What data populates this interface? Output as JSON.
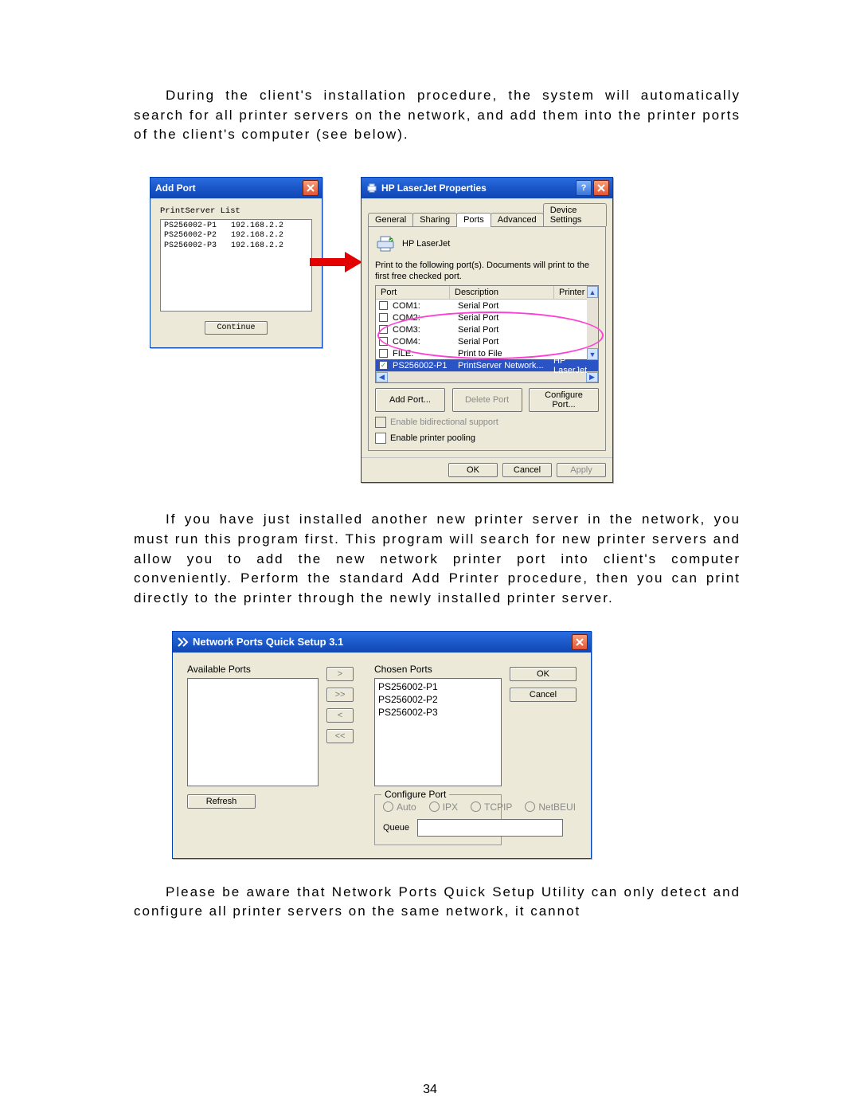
{
  "para1": "During the client's installation procedure, the system will automatically search for all printer servers on the network, and add them into the printer ports of the client's computer (see below).",
  "para2": "If you have just installed another new printer server in the network, you must run this program first. This program will search for new printer servers and allow you to add the new network printer port into client's computer conveniently. Perform the standard Add Printer procedure, then you can print directly to the printer through the newly installed printer server.",
  "para3": "Please be aware that Network Ports Quick Setup Utility can only detect and configure all printer servers on the same network, it cannot",
  "page_number": "34",
  "addport": {
    "title": "Add Port",
    "list_label": "PrintServer List",
    "rows": [
      {
        "name": "PS256002-P1",
        "ip": "192.168.2.2"
      },
      {
        "name": "PS256002-P2",
        "ip": "192.168.2.2"
      },
      {
        "name": "PS256002-P3",
        "ip": "192.168.2.2"
      }
    ],
    "continue": "Continue"
  },
  "props": {
    "title": "HP LaserJet Properties",
    "tabs": [
      "General",
      "Sharing",
      "Ports",
      "Advanced",
      "Device Settings"
    ],
    "active_tab": 2,
    "printer_name": "HP LaserJet",
    "instruction": "Print to the following port(s). Documents will print to the first free checked port.",
    "headers": {
      "port": "Port",
      "desc": "Description",
      "printer": "Printer"
    },
    "rows": [
      {
        "checked": false,
        "port": "COM1:",
        "desc": "Serial Port",
        "printer": ""
      },
      {
        "checked": false,
        "port": "COM2:",
        "desc": "Serial Port",
        "printer": ""
      },
      {
        "checked": false,
        "port": "COM3:",
        "desc": "Serial Port",
        "printer": ""
      },
      {
        "checked": false,
        "port": "COM4:",
        "desc": "Serial Port",
        "printer": ""
      },
      {
        "checked": false,
        "port": "FILE:",
        "desc": "Print to File",
        "printer": ""
      },
      {
        "checked": true,
        "port": "PS256002-P1",
        "desc": "PrintServer Network...",
        "printer": "HP LaserJet"
      }
    ],
    "buttons": {
      "add": "Add Port...",
      "del": "Delete Port",
      "cfg": "Configure Port..."
    },
    "chk_bidir": "Enable bidirectional support",
    "chk_pool": "Enable printer pooling",
    "foot": {
      "ok": "OK",
      "cancel": "Cancel",
      "apply": "Apply"
    }
  },
  "qs": {
    "title": "Network Ports Quick Setup 3.1",
    "available_label": "Available Ports",
    "chosen_label": "Chosen Ports",
    "available": [],
    "chosen": [
      "PS256002-P1",
      "PS256002-P2",
      "PS256002-P3"
    ],
    "movers": [
      ">",
      ">>",
      "<",
      "<<"
    ],
    "ok": "OK",
    "cancel": "Cancel",
    "refresh": "Refresh",
    "configure_legend": "Configure Port",
    "radios": [
      "Auto",
      "IPX",
      "TCPIP",
      "NetBEUI"
    ],
    "queue_label": "Queue"
  }
}
